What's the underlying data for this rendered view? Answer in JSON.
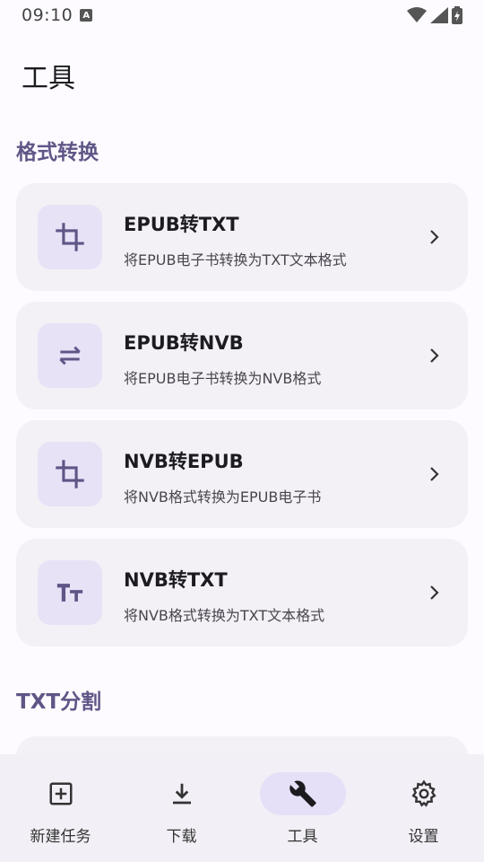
{
  "status": {
    "time": "09:10",
    "indicator": "A"
  },
  "app": {
    "title": "工具"
  },
  "sections": [
    {
      "title": "格式转换"
    },
    {
      "title": "TXT分割"
    }
  ],
  "cards": [
    {
      "title": "EPUB转TXT",
      "desc": "将EPUB电子书转换为TXT文本格式",
      "icon": "crop-icon"
    },
    {
      "title": "EPUB转NVB",
      "desc": "将EPUB电子书转换为NVB格式",
      "icon": "swap-arrows-icon"
    },
    {
      "title": "NVB转EPUB",
      "desc": "将NVB格式转换为EPUB电子书",
      "icon": "crop-icon"
    },
    {
      "title": "NVB转TXT",
      "desc": "将NVB格式转换为TXT文本格式",
      "icon": "text-size-icon"
    }
  ],
  "nav": [
    {
      "label": "新建任务",
      "icon": "add-box-icon"
    },
    {
      "label": "下载",
      "icon": "download-icon"
    },
    {
      "label": "工具",
      "icon": "wrench-icon",
      "active": true
    },
    {
      "label": "设置",
      "icon": "gear-icon"
    }
  ],
  "colors": {
    "accent": "#5f5687",
    "card_bg": "#f4f1f6",
    "icon_bg": "#e8e2f7",
    "nav_active": "#e6dff8"
  }
}
